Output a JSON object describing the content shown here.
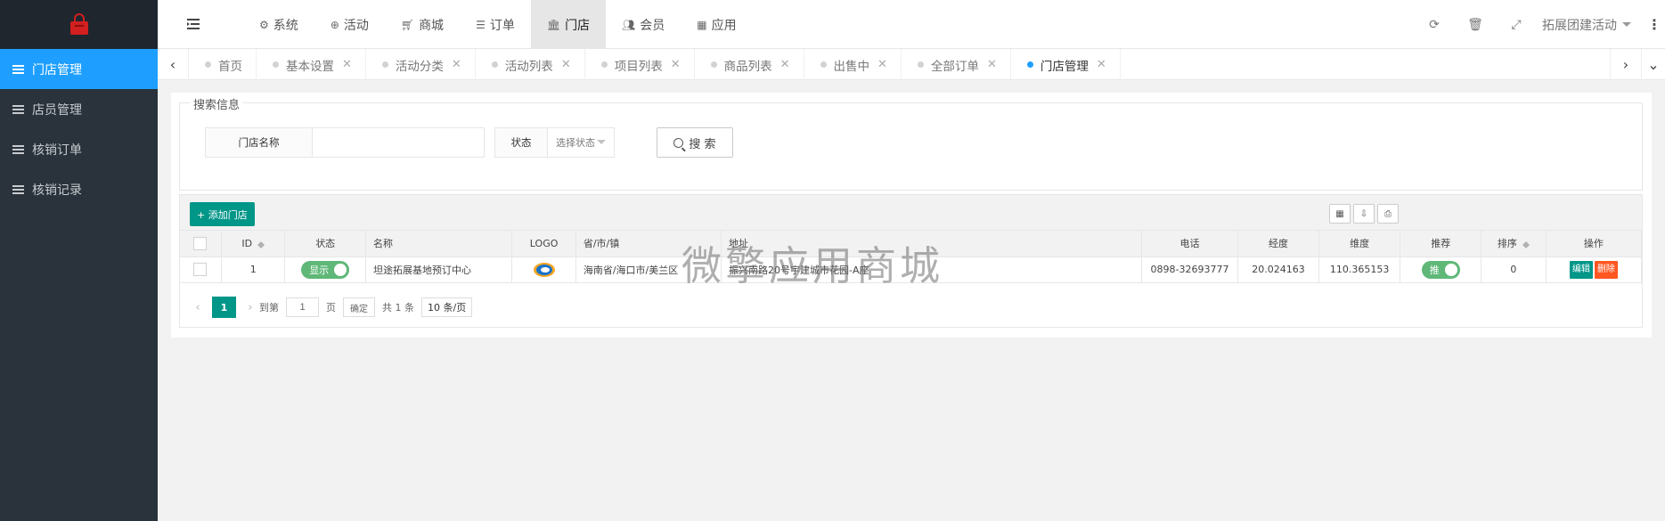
{
  "colors": {
    "sidebar_bg": "#2a323b",
    "active_blue": "#1e9fff",
    "teal": "#009688",
    "danger": "#ff5722",
    "switch_green": "#5fb878"
  },
  "sidebar": {
    "logo_icon": "shopping-bag-icon",
    "items": [
      {
        "label": "门店管理",
        "active": true
      },
      {
        "label": "店员管理"
      },
      {
        "label": "核销订单"
      },
      {
        "label": "核销记录"
      }
    ]
  },
  "header": {
    "menu": [
      {
        "label": "系统",
        "icon": "gears-icon"
      },
      {
        "label": "活动",
        "icon": "globe-icon"
      },
      {
        "label": "商城",
        "icon": "cart-icon"
      },
      {
        "label": "订单",
        "icon": "list-icon"
      },
      {
        "label": "门店",
        "icon": "bank-icon",
        "active": true
      },
      {
        "label": "会员",
        "icon": "users-icon"
      },
      {
        "label": "应用",
        "icon": "grid-icon"
      }
    ],
    "user_label": "拓展团建活动"
  },
  "tabs": [
    {
      "label": "首页"
    },
    {
      "label": "基本设置"
    },
    {
      "label": "活动分类"
    },
    {
      "label": "活动列表"
    },
    {
      "label": "项目列表"
    },
    {
      "label": "商品列表"
    },
    {
      "label": "出售中"
    },
    {
      "label": "全部订单"
    },
    {
      "label": "门店管理",
      "active": true
    }
  ],
  "search": {
    "legend": "搜索信息",
    "name_label": "门店名称",
    "name_value": "",
    "status_label": "状态",
    "status_placeholder": "选择状态",
    "button_label": "搜 索"
  },
  "toolbar": {
    "add_label": "+ 添加门店"
  },
  "table": {
    "headers": {
      "id": "ID",
      "status": "状态",
      "name": "名称",
      "logo": "LOGO",
      "region": "省/市/镇",
      "address": "地址",
      "phone": "电话",
      "lng": "经度",
      "lat": "维度",
      "recommend": "推荐",
      "sort": "排序",
      "ops": "操作"
    },
    "rows": [
      {
        "id": "1",
        "status": "显示",
        "name": "坦途拓展基地预订中心",
        "region": "海南省/海口市/美兰区",
        "address": "振兴南路20号宇建城市花园-A座",
        "phone": "0898-32693777",
        "lng": "20.024163",
        "lat": "110.365153",
        "recommend": "推",
        "sort": "0",
        "edit_label": "编辑",
        "delete_label": "删除"
      }
    ]
  },
  "pager": {
    "current": "1",
    "goto_label": "到第",
    "page_value": "1",
    "page_unit": "页",
    "confirm_label": "确定",
    "total_label": "共 1 条",
    "size_label": "10 条/页"
  },
  "watermark": "微擎应用商城"
}
